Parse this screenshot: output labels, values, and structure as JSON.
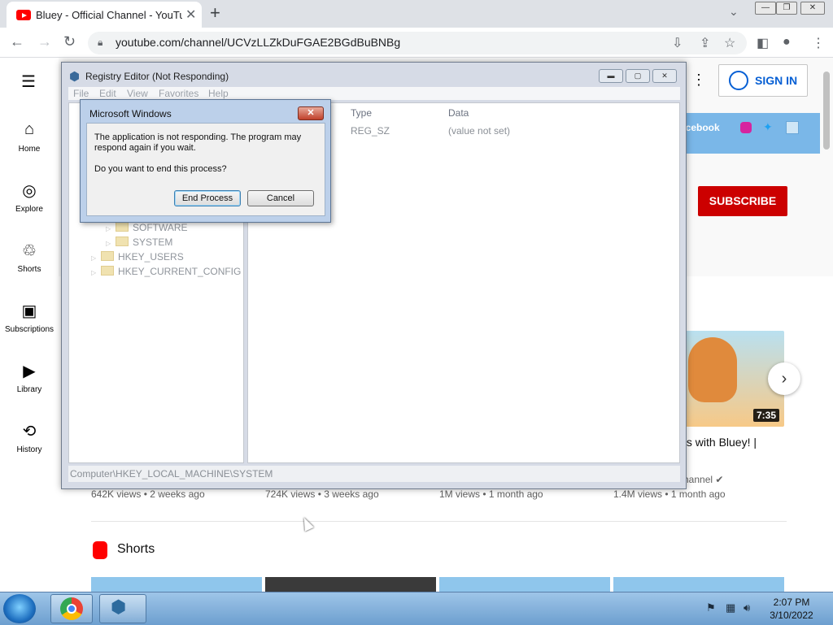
{
  "browser": {
    "tab_title": "Bluey - Official Channel - YouTube",
    "tab_close": "✕",
    "new_tab": "+",
    "url": "youtube.com/channel/UCVzLLZkDuFGAE2BGdBuBNBg"
  },
  "youtube": {
    "nav": [
      {
        "label": "Home",
        "icon": "⌂"
      },
      {
        "label": "Explore",
        "icon": "◎"
      },
      {
        "label": "Shorts",
        "icon": "♲"
      },
      {
        "label": "Subscriptions",
        "icon": "▣"
      },
      {
        "label": "Library",
        "icon": "▶"
      },
      {
        "label": "History",
        "icon": "⟲"
      }
    ],
    "sign_in": "SIGN IN",
    "facebook": "acebook",
    "subscribe": "SUBSCRIBE",
    "video_duration": "7:35",
    "video_title": "ts with Bluey! |",
    "video_channel": "hannel ✔",
    "video_meta": [
      "642K views • 2 weeks ago",
      "724K views • 3 weeks ago",
      "1M views • 1 month ago",
      "1.4M views • 1 month ago"
    ],
    "shorts_title": "Shorts"
  },
  "registry": {
    "title": "Registry Editor (Not Responding)",
    "menu": [
      "File",
      "Edit",
      "View",
      "Favorites",
      "Help"
    ],
    "col_type": "Type",
    "col_data": "Data",
    "row_type": "REG_SZ",
    "row_data": "(value not set)",
    "tree": [
      "SOFTWARE",
      "SYSTEM",
      "HKEY_USERS",
      "HKEY_CURRENT_CONFIG"
    ],
    "status": "Computer\\HKEY_LOCAL_MACHINE\\SYSTEM"
  },
  "dialog": {
    "title": "Microsoft Windows",
    "message": "The application is not responding. The program may respond again if you wait.",
    "question": "Do you want to end this process?",
    "end_process": "End Process",
    "cancel": "Cancel"
  },
  "taskbar": {
    "time": "2:07 PM",
    "date": "3/10/2022"
  }
}
